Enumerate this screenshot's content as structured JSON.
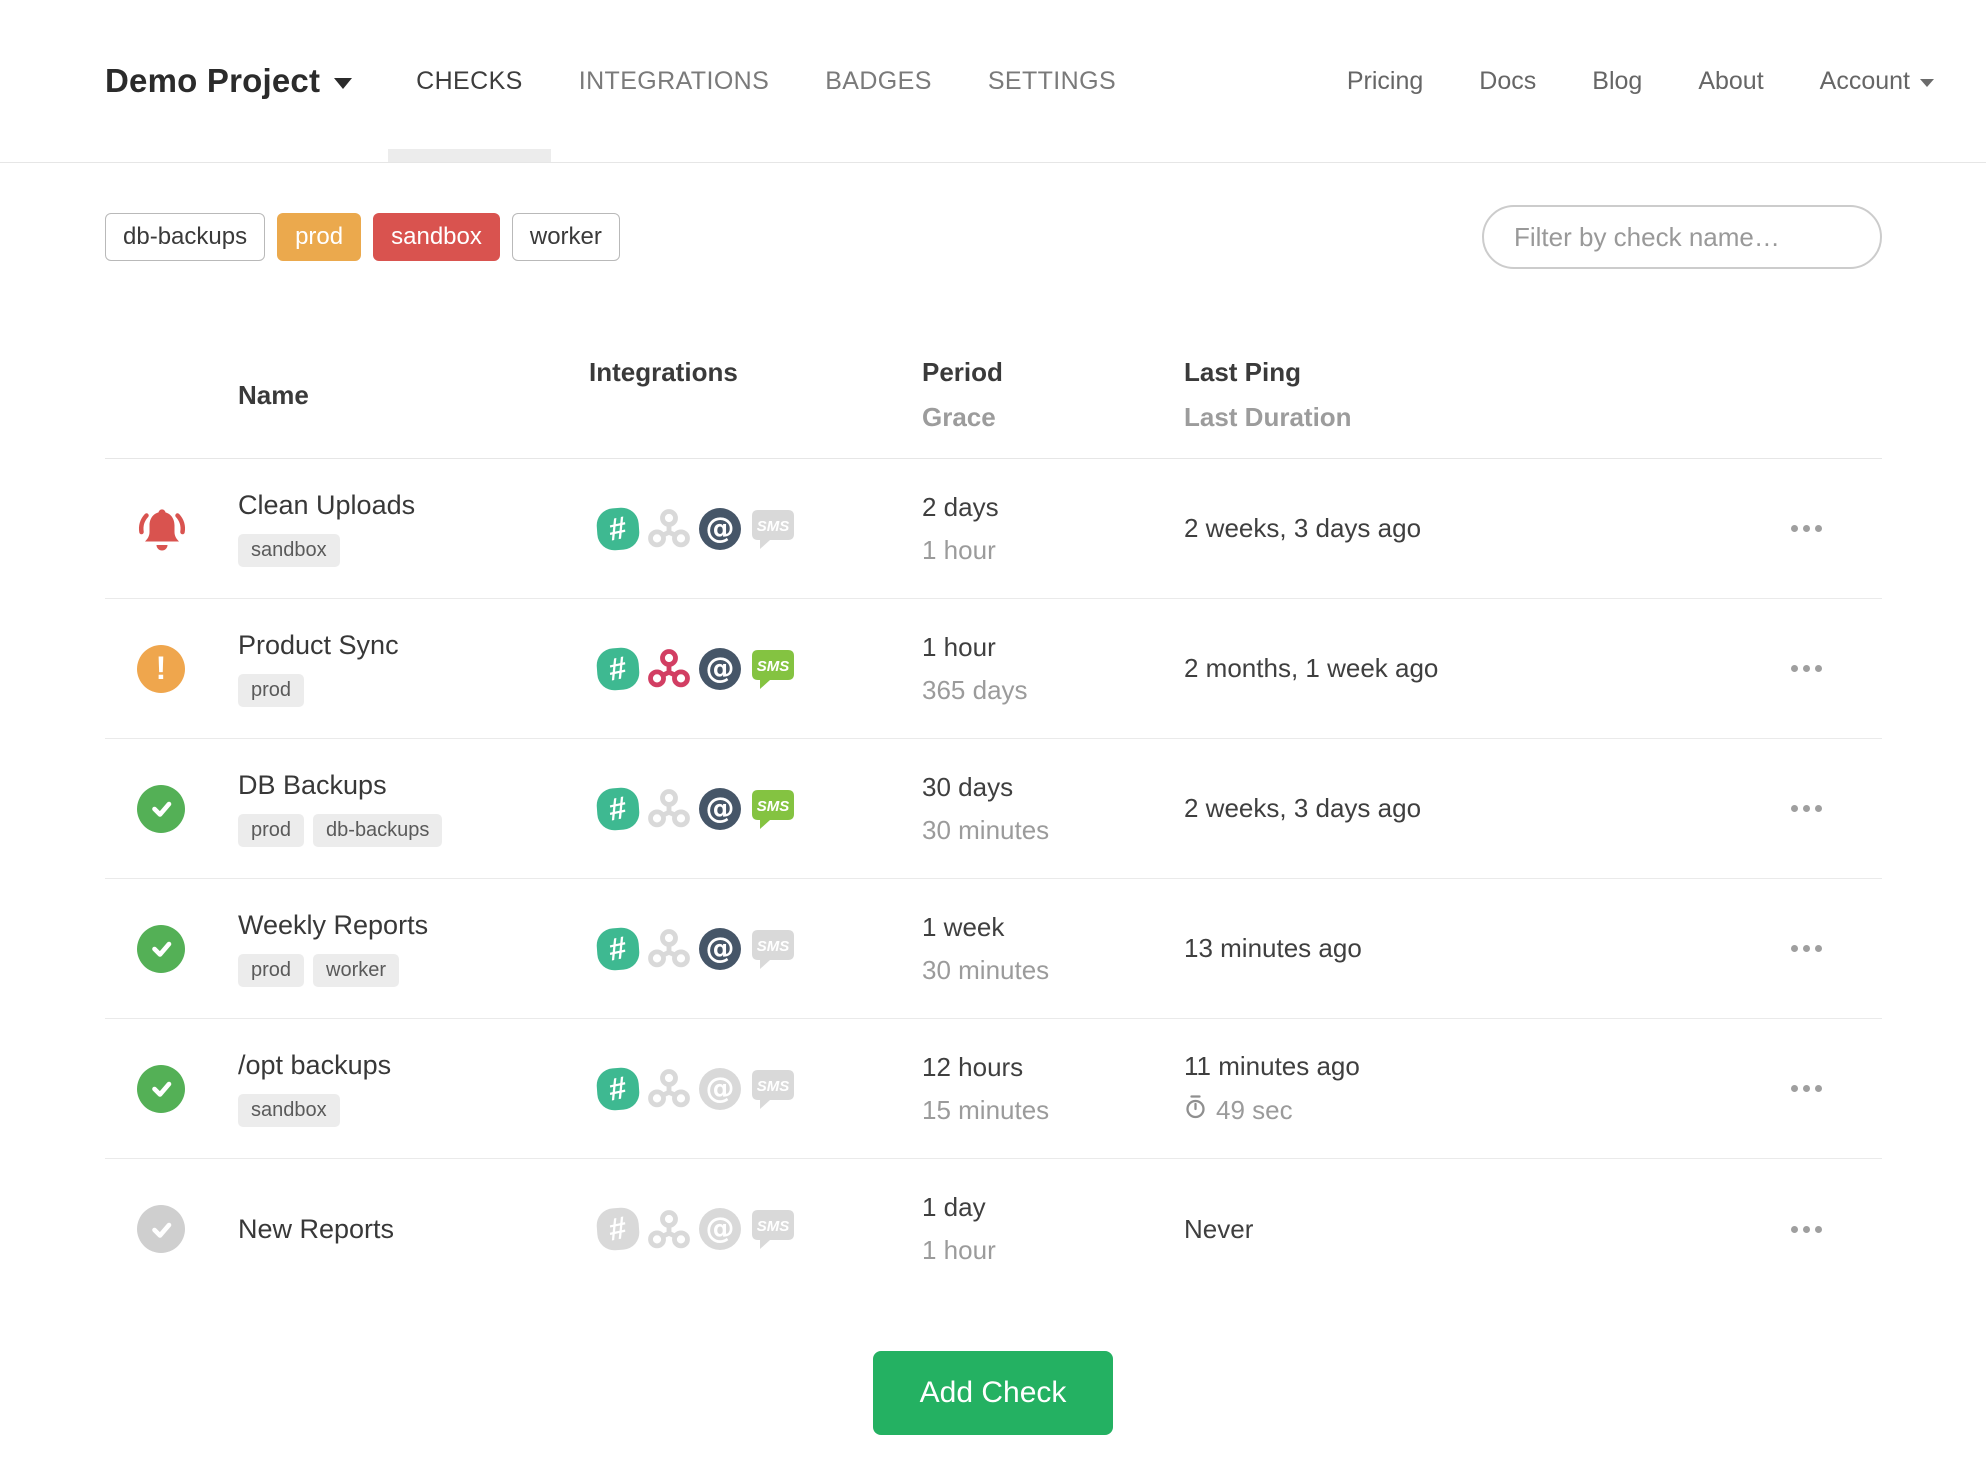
{
  "nav": {
    "project_name": "Demo Project",
    "tabs": [
      {
        "label": "CHECKS",
        "active": true
      },
      {
        "label": "INTEGRATIONS",
        "active": false
      },
      {
        "label": "BADGES",
        "active": false
      },
      {
        "label": "SETTINGS",
        "active": false
      }
    ],
    "links": [
      "Pricing",
      "Docs",
      "Blog",
      "About"
    ],
    "account": "Account"
  },
  "toolbar": {
    "filter_tags": [
      {
        "label": "db-backups",
        "variant": "outline"
      },
      {
        "label": "prod",
        "variant": "warning"
      },
      {
        "label": "sandbox",
        "variant": "danger"
      },
      {
        "label": "worker",
        "variant": "outline"
      }
    ],
    "search_placeholder": "Filter by check name…"
  },
  "table": {
    "headers": {
      "name": "Name",
      "integrations": "Integrations",
      "period": "Period",
      "grace": "Grace",
      "last_ping": "Last Ping",
      "last_duration": "Last Duration"
    },
    "rows": [
      {
        "name": "Clean Uploads",
        "status": "down",
        "tags": [
          "sandbox"
        ],
        "integrations": [
          {
            "type": "slack",
            "active": true
          },
          {
            "type": "webhook",
            "active": false
          },
          {
            "type": "email",
            "active": true
          },
          {
            "type": "sms",
            "active": false
          }
        ],
        "period": "2 days",
        "grace": "1 hour",
        "last_ping": "2 weeks, 3 days ago",
        "last_duration": null
      },
      {
        "name": "Product Sync",
        "status": "grace",
        "tags": [
          "prod"
        ],
        "integrations": [
          {
            "type": "slack",
            "active": true
          },
          {
            "type": "webhook",
            "active": true
          },
          {
            "type": "email",
            "active": true
          },
          {
            "type": "sms",
            "active": true
          }
        ],
        "period": "1 hour",
        "grace": "365 days",
        "last_ping": "2 months, 1 week ago",
        "last_duration": null
      },
      {
        "name": "DB Backups",
        "status": "up",
        "tags": [
          "prod",
          "db-backups"
        ],
        "integrations": [
          {
            "type": "slack",
            "active": true
          },
          {
            "type": "webhook",
            "active": false
          },
          {
            "type": "email",
            "active": true
          },
          {
            "type": "sms",
            "active": true
          }
        ],
        "period": "30 days",
        "grace": "30 minutes",
        "last_ping": "2 weeks, 3 days ago",
        "last_duration": null
      },
      {
        "name": "Weekly Reports",
        "status": "up",
        "tags": [
          "prod",
          "worker"
        ],
        "integrations": [
          {
            "type": "slack",
            "active": true
          },
          {
            "type": "webhook",
            "active": false
          },
          {
            "type": "email",
            "active": true
          },
          {
            "type": "sms",
            "active": false
          }
        ],
        "period": "1 week",
        "grace": "30 minutes",
        "last_ping": "13 minutes ago",
        "last_duration": null
      },
      {
        "name": "/opt backups",
        "status": "up",
        "tags": [
          "sandbox"
        ],
        "integrations": [
          {
            "type": "slack",
            "active": true
          },
          {
            "type": "webhook",
            "active": false
          },
          {
            "type": "email",
            "active": false
          },
          {
            "type": "sms",
            "active": false
          }
        ],
        "period": "12 hours",
        "grace": "15 minutes",
        "last_ping": "11 minutes ago",
        "last_duration": "49 sec"
      },
      {
        "name": "New Reports",
        "status": "new",
        "tags": [],
        "integrations": [
          {
            "type": "slack",
            "active": false
          },
          {
            "type": "webhook",
            "active": false
          },
          {
            "type": "email",
            "active": false
          },
          {
            "type": "sms",
            "active": false
          }
        ],
        "period": "1 day",
        "grace": "1 hour",
        "last_ping": "Never",
        "last_duration": null
      }
    ]
  },
  "add_check_label": "Add Check",
  "colors": {
    "up": "#54b056",
    "grace": "#efa64d",
    "down": "#d9534f",
    "new": "#cfcfcf",
    "slack": "#3eb991",
    "webhook": "#d23e63",
    "email": "#465668",
    "sms": "#84c341",
    "inactive": "#d9d9d9",
    "accent": "#24b162",
    "warning": "#eba94d",
    "danger": "#d9534f"
  }
}
